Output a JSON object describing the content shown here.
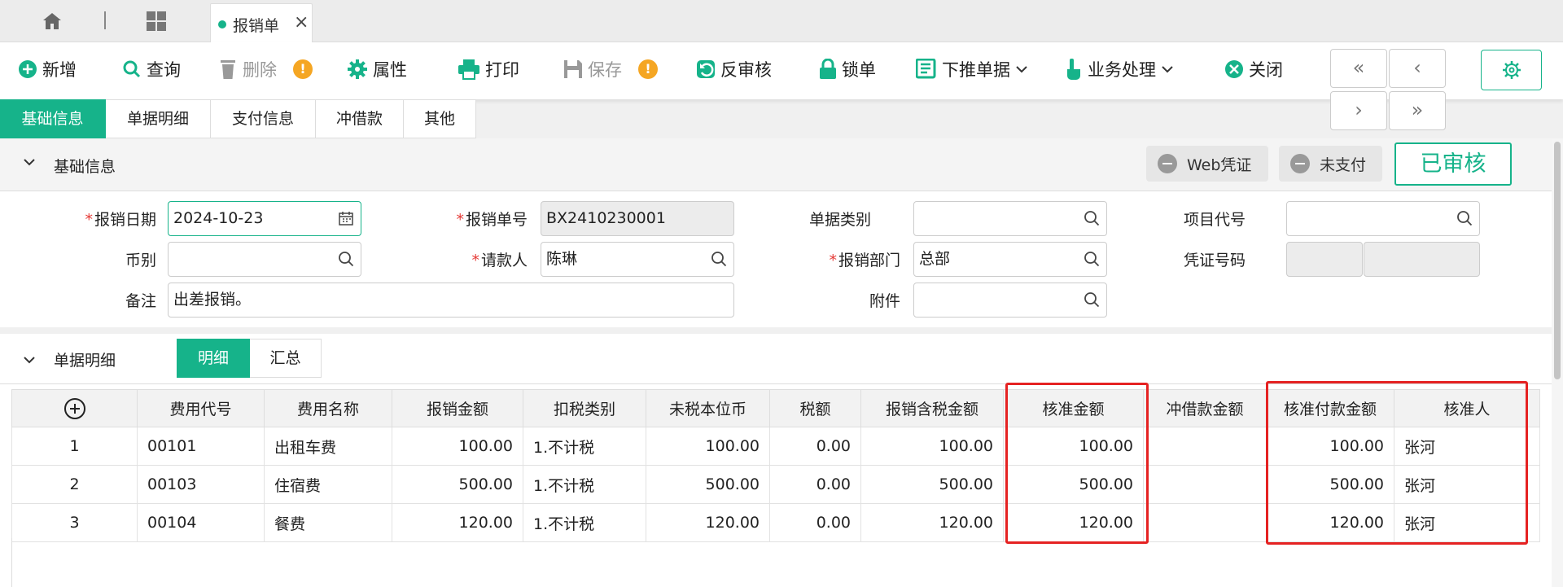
{
  "tabbar": {
    "doc_tab": "报销单"
  },
  "toolbar": {
    "add": "新增",
    "query": "查询",
    "delete": "删除",
    "properties": "属性",
    "print": "打印",
    "save": "保存",
    "unapprove": "反审核",
    "lock": "锁单",
    "push_down": "下推单据",
    "business": "业务处理",
    "close": "关闭",
    "warn_mark": "!",
    "nav": {
      "first": "«",
      "prev": "‹",
      "next": "›",
      "last": "»"
    }
  },
  "subtabs": [
    "基础信息",
    "单据明细",
    "支付信息",
    "冲借款",
    "其他"
  ],
  "basic": {
    "section_title": "基础信息",
    "web_voucher": "Web凭证",
    "unpaid": "未支付",
    "status": "已审核"
  },
  "form": {
    "date_label": "报销日期",
    "date_value": "2024-10-23",
    "billno_label": "报销单号",
    "billno_value": "BX2410230001",
    "billtype_label": "单据类别",
    "billtype_value": "",
    "project_label": "项目代号",
    "project_value": "",
    "currency_label": "币别",
    "currency_value": "",
    "applicant_label": "请款人",
    "applicant_value": "陈琳",
    "dept_label": "报销部门",
    "dept_value": "总部",
    "voucher_label": "凭证号码",
    "remark_label": "备注",
    "remark_value": "出差报销。",
    "attach_label": "附件",
    "attach_value": ""
  },
  "detail": {
    "section_title": "单据明细",
    "seg_detail": "明细",
    "seg_summary": "汇总",
    "columns": [
      "",
      "费用代号",
      "费用名称",
      "报销金额",
      "扣税类别",
      "未税本位币",
      "税额",
      "报销含税金额",
      "核准金额",
      "冲借款金额",
      "核准付款金额",
      "核准人"
    ],
    "rows": [
      [
        "1",
        "00101",
        "出租车费",
        "100.00",
        "1.不计税",
        "100.00",
        "0.00",
        "100.00",
        "100.00",
        "",
        "100.00",
        "张河"
      ],
      [
        "2",
        "00103",
        "住宿费",
        "500.00",
        "1.不计税",
        "500.00",
        "0.00",
        "500.00",
        "500.00",
        "",
        "500.00",
        "张河"
      ],
      [
        "3",
        "00104",
        "餐费",
        "120.00",
        "1.不计税",
        "120.00",
        "0.00",
        "120.00",
        "120.00",
        "",
        "120.00",
        "张河"
      ]
    ]
  },
  "colors": {
    "accent": "#16b38a",
    "highlight": "#e52222",
    "warning": "#f5a623"
  }
}
